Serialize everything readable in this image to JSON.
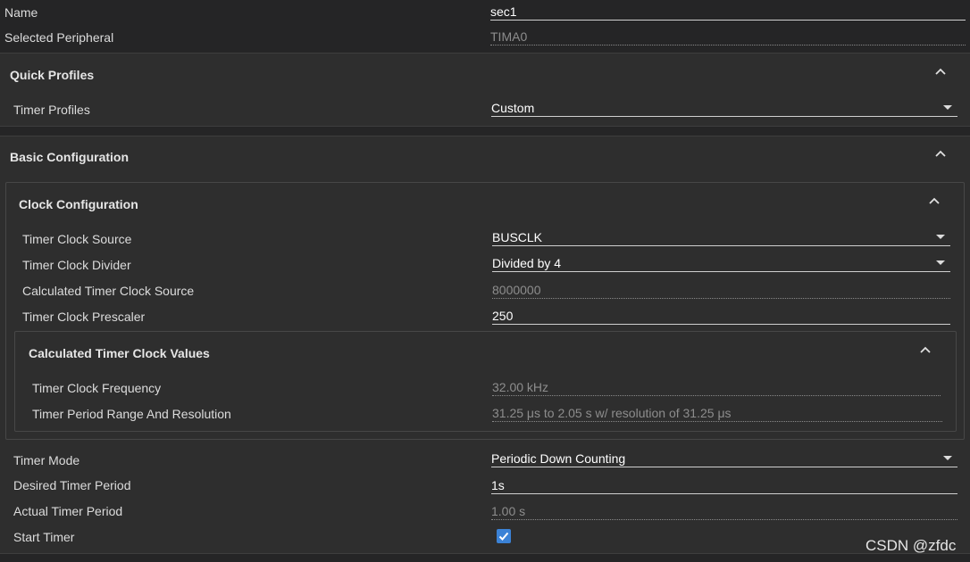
{
  "header": {
    "name_label": "Name",
    "name_value": "sec1",
    "peripheral_label": "Selected Peripheral",
    "peripheral_value": "TIMA0"
  },
  "quick_profiles": {
    "title": "Quick Profiles",
    "timer_profiles_label": "Timer Profiles",
    "timer_profiles_value": "Custom"
  },
  "basic_configuration": {
    "title": "Basic Configuration",
    "clock_configuration": {
      "title": "Clock Configuration",
      "clock_source_label": "Timer Clock Source",
      "clock_source_value": "BUSCLK",
      "clock_divider_label": "Timer Clock Divider",
      "clock_divider_value": "Divided by 4",
      "calc_clock_source_label": "Calculated Timer Clock Source",
      "calc_clock_source_value": "8000000",
      "prescaler_label": "Timer Clock Prescaler",
      "prescaler_value": "250",
      "calculated_values": {
        "title": "Calculated Timer Clock Values",
        "frequency_label": "Timer Clock Frequency",
        "frequency_value": "32.00 kHz",
        "period_range_label": "Timer Period Range And Resolution",
        "period_range_value": "31.25 μs to 2.05 s w/ resolution of 31.25 μs"
      }
    },
    "timer_mode_label": "Timer Mode",
    "timer_mode_value": "Periodic Down Counting",
    "desired_period_label": "Desired Timer Period",
    "desired_period_value": "1s",
    "actual_period_label": "Actual Timer Period",
    "actual_period_value": "1.00 s",
    "start_timer_label": "Start Timer",
    "start_timer_checked": true
  },
  "watermark": "CSDN @zfdc",
  "colors": {
    "background": "#252526",
    "panel": "#2e2e2e",
    "checkbox_accent": "#3b82d6"
  }
}
